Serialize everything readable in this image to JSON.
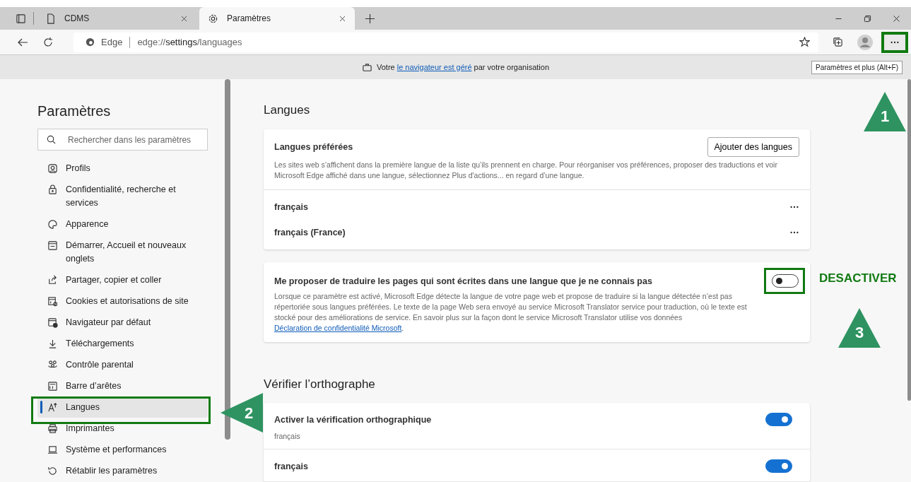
{
  "browser": {
    "tabs": [
      {
        "title": "CDMS",
        "selected": false
      },
      {
        "title": "Paramètres",
        "selected": true
      }
    ],
    "address": {
      "site": "Edge",
      "scheme": "edge://",
      "host": "settings",
      "path": "/languages"
    },
    "tooltip": "Paramètres et plus (Alt+F)"
  },
  "info_bar": {
    "before": "Votre",
    "link": "le navigateur est géré",
    "after": "par votre organisation"
  },
  "sidebar": {
    "title": "Paramètres",
    "search": {
      "placeholder": "Rechercher dans les paramètres"
    },
    "items": [
      {
        "label": "Profils",
        "selected": false
      },
      {
        "label": "Confidentialité, recherche et services",
        "selected": false
      },
      {
        "label": "Apparence",
        "selected": false
      },
      {
        "label": "Démarrer, Accueil et nouveaux onglets",
        "selected": false
      },
      {
        "label": "Partager, copier et coller",
        "selected": false
      },
      {
        "label": "Cookies et autorisations de site",
        "selected": false
      },
      {
        "label": "Navigateur par défaut",
        "selected": false
      },
      {
        "label": "Téléchargements",
        "selected": false
      },
      {
        "label": "Contrôle parental",
        "selected": false
      },
      {
        "label": "Barre d’arêtes",
        "selected": false
      },
      {
        "label": "Langues",
        "selected": true
      },
      {
        "label": "Imprimantes",
        "selected": false
      },
      {
        "label": "Système et performances",
        "selected": false
      },
      {
        "label": "Rétablir les paramètres",
        "selected": false
      }
    ]
  },
  "content": {
    "languages": {
      "title": "Langues",
      "preferred": {
        "title": "Langues préférées",
        "button": "Ajouter des langues",
        "description": "Les sites web s’affichent dans la première langue de la liste qu’ils prennent en charge. Pour réorganiser vos préférences, proposer des traductions et voir Microsoft Edge affiché dans une langue, sélectionnez Plus d'actions... en regard d’une langue.",
        "list": [
          "français",
          "français (France)"
        ]
      },
      "translate": {
        "title": "Me proposer de traduire les pages qui sont écrites dans une langue que je ne connais pas",
        "on": false,
        "description": "Lorsque ce paramètre est activé, Microsoft Edge détecte la langue de votre page web et propose de traduire si la langue détectée n’est pas répertoriée sous langues préférées. Le texte de la page Web sera envoyé au service Microsoft Translator service pour traduction, où le texte est stocké pour des améliorations de service. En savoir plus sur la façon dont le service Microsoft Translator utilise vos données",
        "link": "Déclaration de confidentialité Microsoft",
        "after": "."
      }
    },
    "spellcheck": {
      "title": "Vérifier l’orthographe",
      "rows": [
        {
          "title": "Activer la vérification orthographique",
          "subtitle": "français",
          "on": true
        },
        {
          "title": "français",
          "on": true
        }
      ]
    }
  },
  "annotations": {
    "markers": [
      "1",
      "2",
      "3"
    ],
    "note": "DESACTIVER"
  }
}
